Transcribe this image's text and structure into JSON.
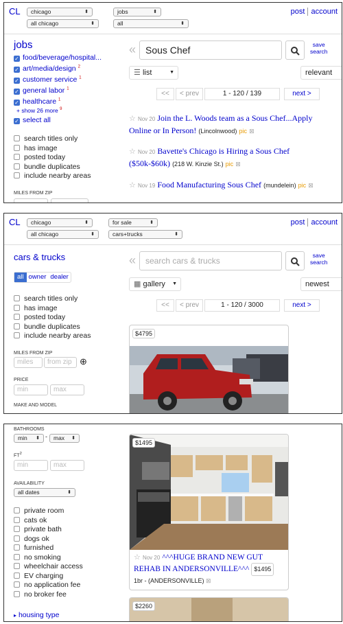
{
  "header": {
    "logo": "CL",
    "post": "post",
    "account": "account",
    "save_search": "save\nsearch"
  },
  "p1": {
    "sel_city": "chicago",
    "sel_area": "all chicago",
    "sel_cat": "jobs",
    "sel_sub": "all",
    "section_title": "jobs",
    "categories": [
      {
        "label": "food/beverage/hospital...",
        "count": ""
      },
      {
        "label": "art/media/design",
        "count": "2"
      },
      {
        "label": "customer service",
        "count": "1"
      },
      {
        "label": "general labor",
        "count": "1"
      },
      {
        "label": "healthcare",
        "count": "1"
      }
    ],
    "show_more": "+ show 26 more",
    "show_more_count": "9",
    "select_all": "select all",
    "filters": [
      "search titles only",
      "has image",
      "posted today",
      "bundle duplicates",
      "include nearby areas"
    ],
    "miles_label": "MILES FROM ZIP",
    "search_value": "Sous Chef",
    "view": "list",
    "sort": "relevant",
    "pager": {
      "first": "<<",
      "prev": "< prev",
      "range": "1 - 120 / 139",
      "next": "next >"
    },
    "results": [
      {
        "date": "Nov 20",
        "title": "Join the L. Woods team as a Sous Chef...Apply Online or In Person!",
        "loc": "(Lincolnwood)",
        "pic": "pic"
      },
      {
        "date": "Nov 20",
        "title": "Bavette's Chicago is Hiring a Sous Chef ($50k-$60k)",
        "loc": "(218 W. Kinzie St.)",
        "pic": "pic"
      },
      {
        "date": "Nov 19",
        "title": "Food Manufacturing Sous Chef",
        "loc": "(mundelein)",
        "pic": "pic"
      }
    ]
  },
  "p2": {
    "sel_city": "chicago",
    "sel_area": "all chicago",
    "sel_cat": "for sale",
    "sel_sub": "cars+trucks",
    "section_title": "cars & trucks",
    "seg": [
      "all",
      "owner",
      "dealer"
    ],
    "filters": [
      "search titles only",
      "has image",
      "posted today",
      "bundle duplicates",
      "include nearby areas"
    ],
    "miles_label": "MILES FROM ZIP",
    "miles_ph": "miles",
    "zip_ph": "from zip",
    "price_label": "PRICE",
    "min_ph": "min",
    "max_ph": "max",
    "make_label": "MAKE AND MODEL",
    "search_ph": "search cars & trucks",
    "view": "gallery",
    "sort": "newest",
    "pager": {
      "first": "<<",
      "prev": "< prev",
      "range": "1 - 120 / 3000",
      "next": "next >"
    },
    "card_price": "$4795"
  },
  "p3": {
    "bath_label": "BATHROOMS",
    "bath_min": "min",
    "bath_max": "max",
    "ft_label": "FT",
    "ft_sup": "2",
    "min_ph": "min",
    "max_ph": "max",
    "avail_label": "AVAILABILITY",
    "avail_value": "all dates",
    "filters": [
      "private room",
      "cats ok",
      "private bath",
      "dogs ok",
      "furnished",
      "no smoking",
      "wheelchair access",
      "EV charging",
      "no application fee",
      "no broker fee"
    ],
    "housing_type": "housing type",
    "card1": {
      "price": "$1495",
      "date": "Nov 20",
      "title": "^^^HUGE BRAND NEW GUT REHAB IN ANDERSONVILLE^^^",
      "price2": "$1495",
      "sub": "1br - (ANDERSONVILLE)"
    },
    "card2_price": "$2260"
  }
}
